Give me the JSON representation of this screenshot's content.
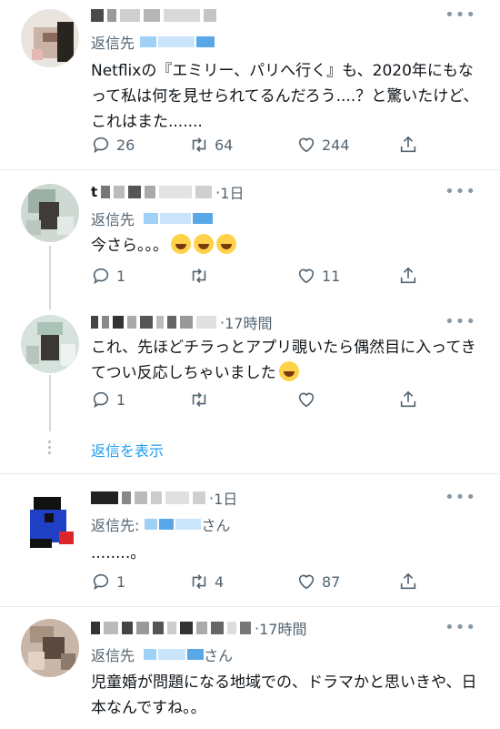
{
  "tweets": [
    {
      "reply_prefix": "返信先",
      "text": "Netflixの『エミリー、パリへ行く』も、2020年にもなって私は何を見せられてるんだろう....？と驚いたけど、これはまた.......",
      "reply_count": "26",
      "retweet_count": "64",
      "like_count": "244"
    },
    {
      "handle_initial": "t",
      "time": "1日",
      "reply_prefix": "返信先",
      "text": "今さら。。。",
      "reply_count": "1",
      "retweet_count": "",
      "like_count": "11"
    },
    {
      "time": "17時間",
      "text": "これ、先ほどチラっとアプリ覗いたら偶然目に入ってきてつい反応しちゃいました",
      "reply_count": "1",
      "retweet_count": "",
      "like_count": ""
    },
    {
      "time": "1日",
      "reply_prefix": "返信先:",
      "reply_suffix": "さん",
      "text": "........。",
      "reply_count": "1",
      "retweet_count": "4",
      "like_count": "87"
    },
    {
      "time": "17時間",
      "reply_prefix": "返信先",
      "reply_suffix": "さん",
      "text": "児童婚が問題になる地域での、ドラマかと思いきや、日本なんですね。。"
    }
  ],
  "show_replies": "返信を表示",
  "more_label": "•••",
  "icons": {
    "reply": "reply-icon",
    "retweet": "retweet-icon",
    "like": "heart-icon",
    "share": "share-icon"
  }
}
